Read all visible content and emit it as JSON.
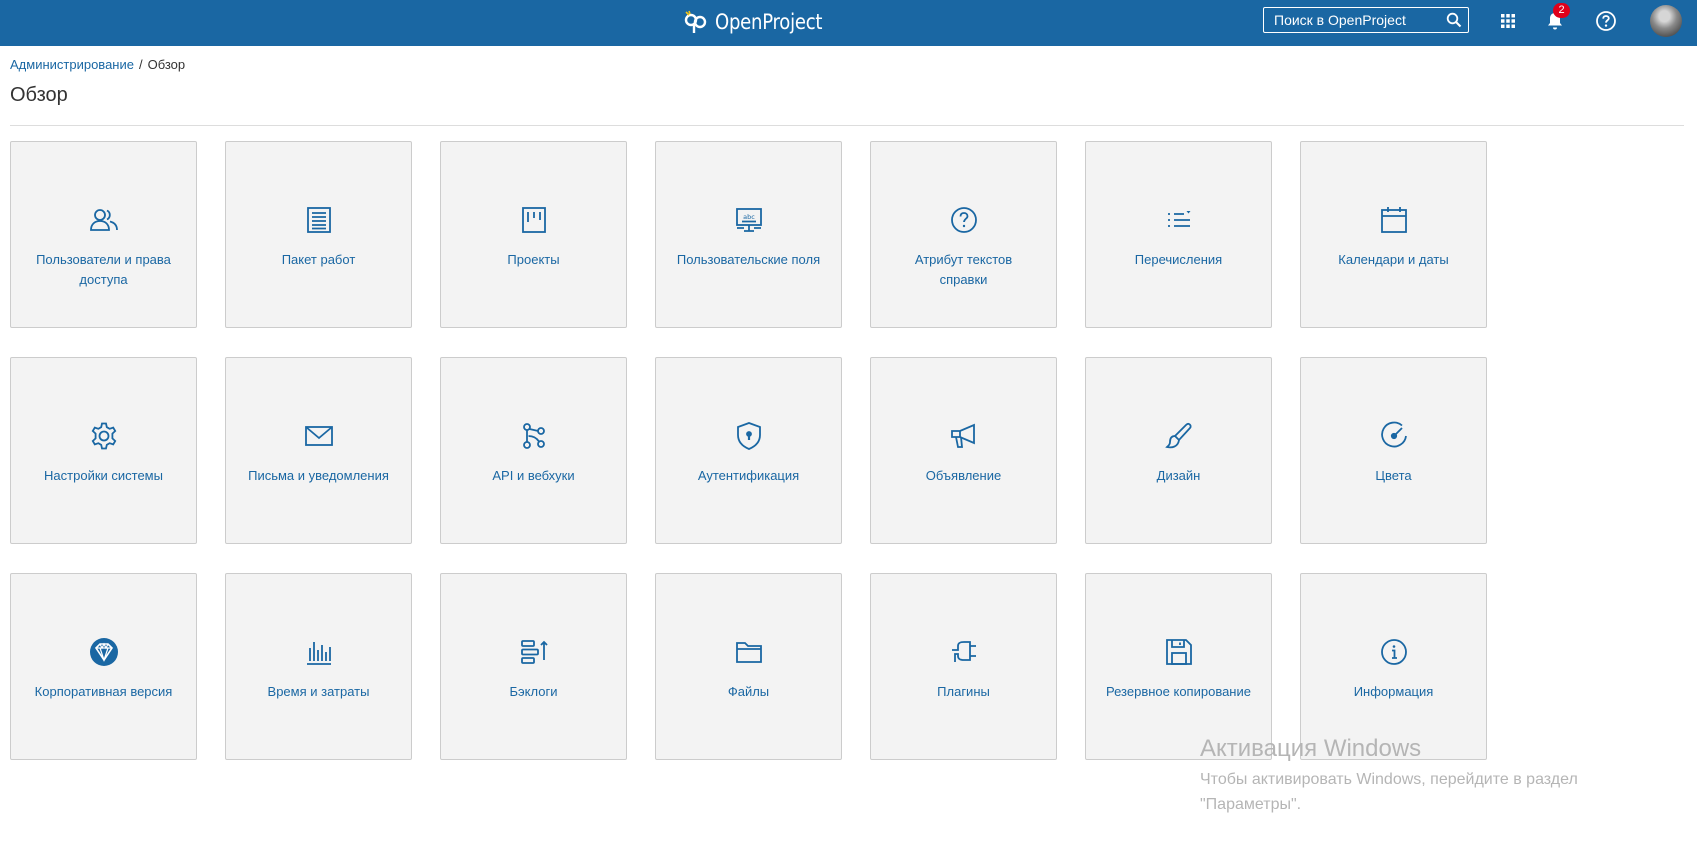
{
  "app": {
    "name": "OpenProject"
  },
  "header": {
    "search_placeholder": "Поиск в OpenProject",
    "notifications_count": "2",
    "icons": [
      "search-icon",
      "modules-grid-icon",
      "bell-icon",
      "help-icon"
    ]
  },
  "breadcrumb": {
    "parent": "Администрирование",
    "separator": "/",
    "current": "Обзор"
  },
  "page": {
    "title": "Обзор"
  },
  "tiles": [
    {
      "label": "Пользователи и права доступа",
      "icon": "users-icon"
    },
    {
      "label": "Пакет работ",
      "icon": "work-package-icon"
    },
    {
      "label": "Проекты",
      "icon": "projects-icon"
    },
    {
      "label": "Пользовательские поля",
      "icon": "custom-fields-icon"
    },
    {
      "label": "Атрибут текстов справки",
      "icon": "help-question-icon"
    },
    {
      "label": "Перечисления",
      "icon": "enumerations-icon"
    },
    {
      "label": "Календари и даты",
      "icon": "calendar-icon"
    },
    {
      "label": "Настройки системы",
      "icon": "gear-icon"
    },
    {
      "label": "Письма и уведомления",
      "icon": "mail-icon"
    },
    {
      "label": "API и вебхуки",
      "icon": "api-icon"
    },
    {
      "label": "Аутентификация",
      "icon": "shield-lock-icon"
    },
    {
      "label": "Объявление",
      "icon": "megaphone-icon"
    },
    {
      "label": "Дизайн",
      "icon": "brush-icon"
    },
    {
      "label": "Цвета",
      "icon": "color-dial-icon"
    },
    {
      "label": "Корпоративная версия",
      "icon": "enterprise-icon"
    },
    {
      "label": "Время и затраты",
      "icon": "time-costs-icon"
    },
    {
      "label": "Бэклоги",
      "icon": "backlogs-icon"
    },
    {
      "label": "Файлы",
      "icon": "folder-icon"
    },
    {
      "label": "Плагины",
      "icon": "plugin-icon"
    },
    {
      "label": "Резервное копирование",
      "icon": "save-icon"
    },
    {
      "label": "Информация",
      "icon": "info-icon"
    }
  ],
  "watermark": {
    "title": "Активация Windows",
    "text": "Чтобы активировать Windows, перейдите в раздел \"Параметры\"."
  },
  "colors": {
    "header_bg": "#1a67a3",
    "link": "#1a67a3",
    "tile_bg": "#f3f3f3",
    "badge": "#e0001a"
  }
}
